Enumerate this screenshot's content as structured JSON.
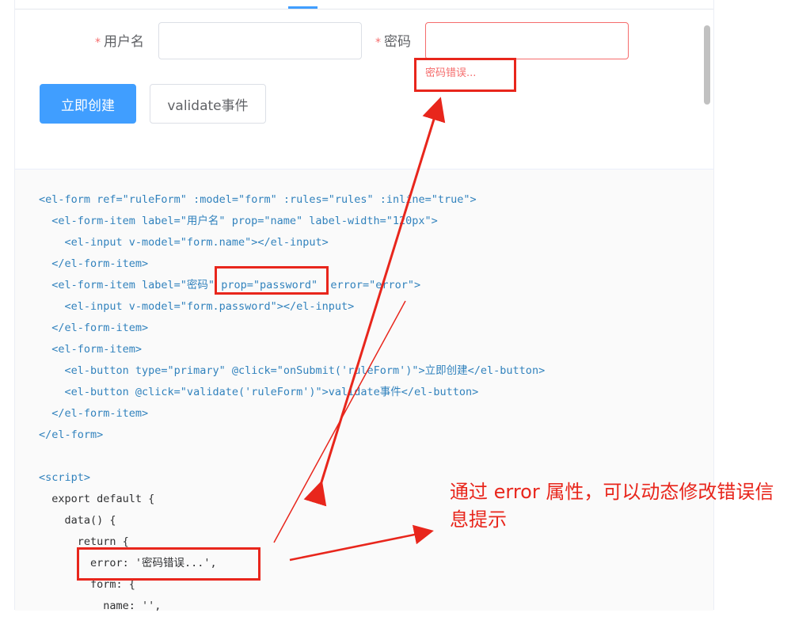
{
  "form": {
    "username_label": "用户名",
    "password_label": "密码",
    "required_mark": "*",
    "password_error": "密码错误...",
    "submit_button": "立即创建",
    "validate_button": "validate事件"
  },
  "code_lines": [
    "<el-form ref=\"ruleForm\" :model=\"form\" :rules=\"rules\" :inline=\"true\">",
    "  <el-form-item label=\"用户名\" prop=\"name\" label-width=\"120px\">",
    "    <el-input v-model=\"form.name\"></el-input>",
    "  </el-form-item>",
    "  <el-form-item label=\"密码\" prop=\"password\" :error=\"error\">",
    "    <el-input v-model=\"form.password\"></el-input>",
    "  </el-form-item>",
    "  <el-form-item>",
    "    <el-button type=\"primary\" @click=\"onSubmit('ruleForm')\">立即创建</el-button>",
    "    <el-button @click=\"validate('ruleForm')\">validate事件</el-button>",
    "  </el-form-item>",
    "</el-form>",
    "",
    "<script>",
    "  export default {",
    "    data() {",
    "      return {",
    "        error: '密码错误...',",
    "        form: {",
    "          name: '',"
  ],
  "annotation": "通过 error 属性，可以动态修改错误信息提示",
  "colors": {
    "primary": "#409eff",
    "danger": "#f56c6c",
    "annotation": "#e8261c"
  }
}
